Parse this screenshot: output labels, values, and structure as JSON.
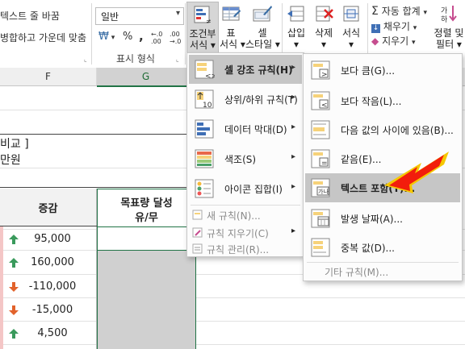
{
  "ribbon": {
    "wrap_text": "텍스트 줄 바꿈",
    "merge_center": "병합하고 가운데 맞춤",
    "number_format_value": "일반",
    "currency_symbol": "₩",
    "percent_symbol": "%",
    "comma_symbol": ",",
    "increase_decimal": "←.0 .00",
    "decrease_decimal": ".00 →.0",
    "number_group_label": "표시 형식",
    "cond_format_label": "조건부\n서식",
    "cond_format_line1": "조건부",
    "cond_format_line2": "서식 ▾",
    "table_format_line1": "표",
    "table_format_line2": "서식 ▾",
    "cell_style_line1": "셀",
    "cell_style_line2": "스타일 ▾",
    "insert_line1": "삽입",
    "insert_line2": "▾",
    "delete_line1": "삭제",
    "delete_line2": "▾",
    "format_line1": "서식",
    "format_line2": "▾",
    "autosum": "자동 합계",
    "fill": "채우기",
    "clear": "지우기",
    "sort_filter_line1": "정렬 및",
    "sort_filter_line2": "필터 ▾"
  },
  "grid": {
    "col_f": "F",
    "col_g": "G",
    "title_partial": "비교 ]",
    "unit_partial": "만원",
    "header_change": "증감",
    "header_target_line1": "목표량 달성",
    "header_target_line2": "유/무",
    "rows": [
      {
        "value": "95,000",
        "dir": "up"
      },
      {
        "value": "160,000",
        "dir": "up"
      },
      {
        "value": "-110,000",
        "dir": "down"
      },
      {
        "value": "-15,000",
        "dir": "down"
      },
      {
        "value": "4,500",
        "dir": "up"
      }
    ]
  },
  "menu_main": {
    "highlight": "셀 강조 규칙(H)",
    "top_bottom": "상위/하위 규칙(T)",
    "data_bars": "데이터 막대(D)",
    "color_scales": "색조(S)",
    "icon_sets": "아이콘 집합(I)",
    "new_rule": "새 규칙(N)...",
    "clear_rules": "규칙 지우기(C)",
    "manage_rules": "규칙 관리(R)..."
  },
  "menu_sub": {
    "greater": "보다 큼(G)...",
    "less": "보다 작음(L)...",
    "between": "다음 값의 사이에 있음(B)...",
    "equal": "같음(E)...",
    "text_contains": "텍스트 포함(T)...",
    "date_occurring": "발생 날짜(A)...",
    "duplicate": "중복 값(D)...",
    "more_rules": "기타 규칙(M)..."
  },
  "colors": {
    "accent_green": "#217346",
    "arrow_up": "#3a9a5c",
    "arrow_down": "#e2622b",
    "pointer_red": "#f21d0c",
    "pointer_yellow": "#f5c800",
    "selection_gray": "#d0d0d0"
  }
}
